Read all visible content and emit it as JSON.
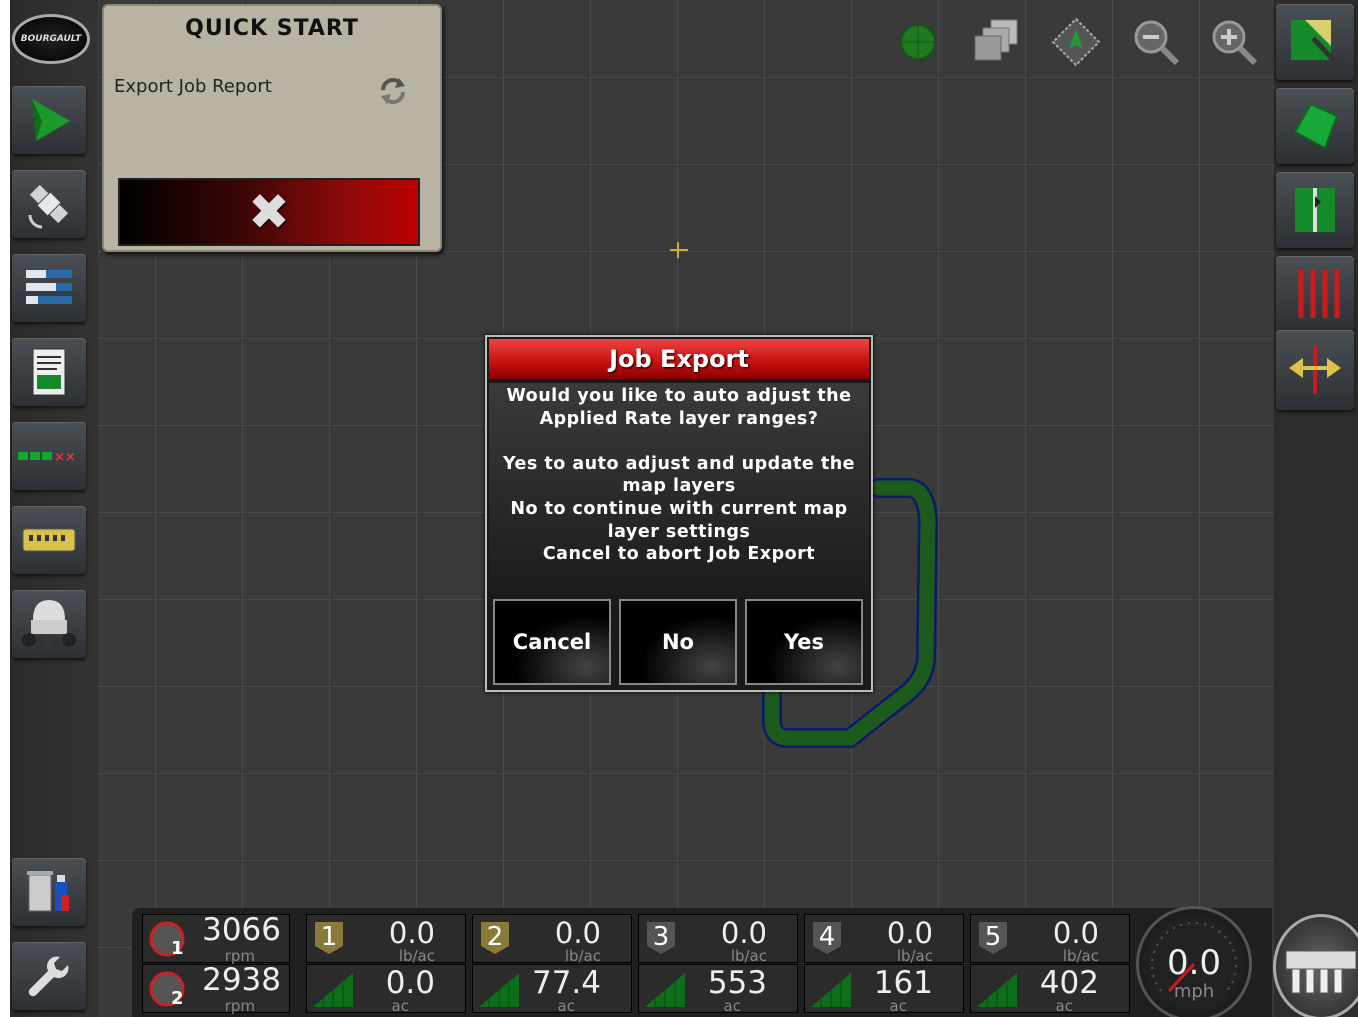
{
  "brand": {
    "logo_text": "BOURGAULT"
  },
  "quick_start": {
    "title": "QUICK START",
    "item": "Export Job Report",
    "close_symbol": "✖"
  },
  "dialog": {
    "title": "Job Export",
    "lines": [
      "Would you like to auto adjust the",
      "Applied Rate layer ranges?",
      "",
      "Yes to auto adjust and update the",
      "map layers",
      "No to continue with current map",
      "layer settings",
      "Cancel to abort Job Export"
    ],
    "buttons": {
      "cancel": "Cancel",
      "no": "No",
      "yes": "Yes"
    }
  },
  "bottom": {
    "fans": [
      {
        "badge": "1",
        "value": "3066",
        "unit": "rpm"
      },
      {
        "badge": "2",
        "value": "2938",
        "unit": "rpm"
      }
    ],
    "products": [
      {
        "id": "1",
        "rate": "0.0",
        "rate_unit": "lb/ac",
        "area": "0.0",
        "area_unit": "ac",
        "badge_color": "#8a7a3a"
      },
      {
        "id": "2",
        "rate": "0.0",
        "rate_unit": "lb/ac",
        "area": "77.4",
        "area_unit": "ac",
        "badge_color": "#8a7a3a"
      },
      {
        "id": "3",
        "rate": "0.0",
        "rate_unit": "lb/ac",
        "area": "553",
        "area_unit": "ac",
        "badge_color": "#555555"
      },
      {
        "id": "4",
        "rate": "0.0",
        "rate_unit": "lb/ac",
        "area": "161",
        "area_unit": "ac",
        "badge_color": "#555555"
      },
      {
        "id": "5",
        "rate": "0.0",
        "rate_unit": "lb/ac",
        "area": "402",
        "area_unit": "ac",
        "badge_color": "#555555"
      }
    ],
    "speed": {
      "value": "0.0",
      "unit": "mph"
    }
  },
  "icons": {
    "left": [
      "logo",
      "guidance-arrow-icon",
      "satellite-icon",
      "bars-icon",
      "document-icon",
      "sections-icon",
      "controller-icon",
      "tank-icon",
      "trash-usb-icon",
      "wrench-icon"
    ],
    "right": [
      "map-pencil-icon",
      "field-boundary-icon",
      "field-flag-icon",
      "guide-lines-icon",
      "nudge-icon"
    ],
    "top": [
      "gps-status-icon",
      "layers-icon",
      "view-icon",
      "zoom-out-icon",
      "zoom-in-icon"
    ]
  },
  "colors": {
    "accent_red": "#cc1111",
    "map_path": "#1d5a1d",
    "map_path_edge": "#0b1a6a"
  }
}
